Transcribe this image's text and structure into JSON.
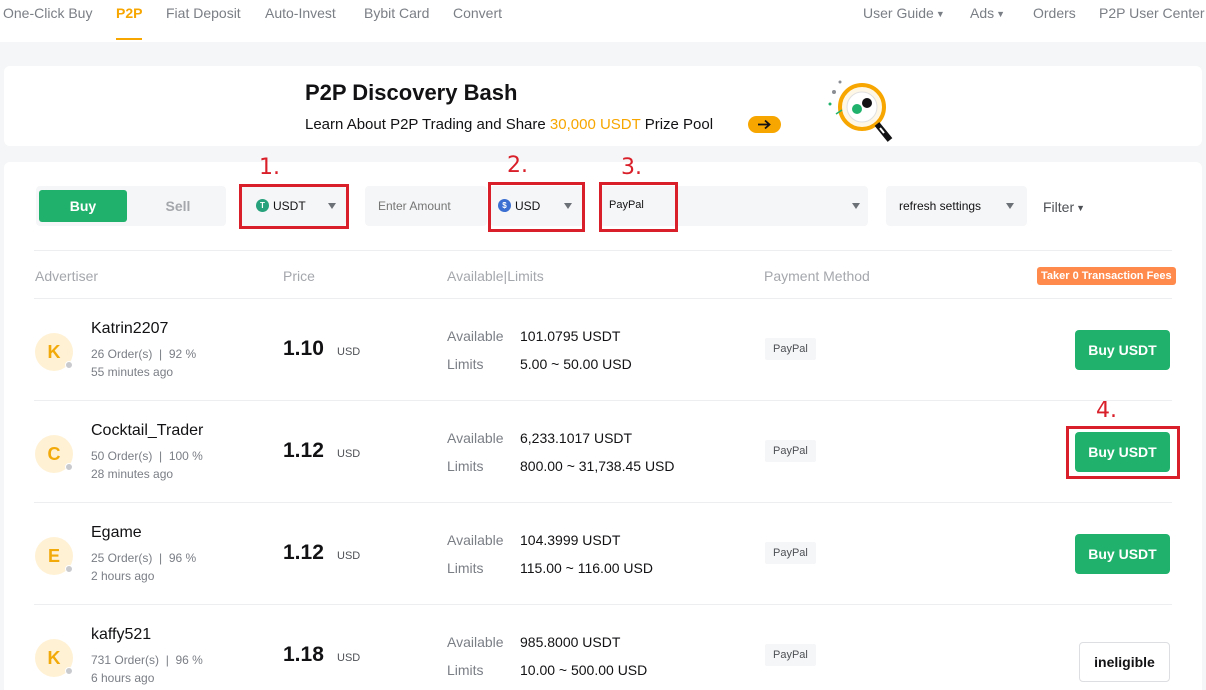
{
  "nav": {
    "left_items": [
      {
        "label": "One-Click Buy"
      },
      {
        "label": "P2P"
      },
      {
        "label": "Fiat Deposit"
      },
      {
        "label": "Auto-Invest"
      },
      {
        "label": "Bybit Card"
      },
      {
        "label": "Convert"
      }
    ],
    "active_item": "P2P",
    "right_items": [
      {
        "label": "User Guide"
      },
      {
        "label": "Ads"
      },
      {
        "label": "Orders"
      },
      {
        "label": "P2P User Center"
      }
    ]
  },
  "banner": {
    "title": "P2P Discovery Bash",
    "subtitle_before": "Learn About P2P Trading and Share ",
    "subtitle_highlight": "30,000 USDT",
    "subtitle_after": " Prize Pool",
    "accent_color": "#f7a600"
  },
  "filters": {
    "buy_label": "Buy",
    "sell_label": "Sell",
    "crypto": {
      "value": "USDT",
      "icon": "tether-coin-icon"
    },
    "amount_placeholder": "Enter Amount",
    "fiat": {
      "value": "USD",
      "icon": "dollar-coin-icon"
    },
    "payment": {
      "value": "PayPal"
    },
    "refresh": {
      "value": "refresh settings"
    },
    "filter_label": "Filter"
  },
  "annotations": {
    "step1": "1.",
    "step2": "2.",
    "step3": "3.",
    "step4": "4.",
    "color": "#d9202a"
  },
  "table": {
    "headers": {
      "advertiser": "Advertiser",
      "price": "Price",
      "available_limits": "Available|Limits",
      "payment_method": "Payment Method"
    },
    "fee_badge": "Taker 0 Transaction Fees",
    "available_label": "Available",
    "limits_label": "Limits",
    "rows": [
      {
        "initial": "K",
        "name": "Katrin2207",
        "orders": "26 Order(s)",
        "completion": "92 %",
        "last_seen": "55 minutes ago",
        "price": "1.10",
        "price_currency": "USD",
        "available": "101.0795 USDT",
        "limits": "5.00 ~ 50.00 USD",
        "payment": "PayPal",
        "action": "Buy USDT"
      },
      {
        "initial": "C",
        "name": "Cocktail_Trader",
        "orders": "50 Order(s)",
        "completion": "100 %",
        "last_seen": "28 minutes ago",
        "price": "1.12",
        "price_currency": "USD",
        "available": "6,233.1017 USDT",
        "limits": "800.00 ~ 31,738.45 USD",
        "payment": "PayPal",
        "action": "Buy USDT"
      },
      {
        "initial": "E",
        "name": "Egame",
        "orders": "25 Order(s)",
        "completion": "96 %",
        "last_seen": "2 hours ago",
        "price": "1.12",
        "price_currency": "USD",
        "available": "104.3999 USDT",
        "limits": "115.00 ~ 116.00 USD",
        "payment": "PayPal",
        "action": "Buy USDT"
      },
      {
        "initial": "K",
        "name": "kaffy521",
        "orders": "731 Order(s)",
        "completion": "96 %",
        "last_seen": "6 hours ago",
        "price": "1.18",
        "price_currency": "USD",
        "available": "985.8000 USDT",
        "limits": "10.00 ~ 500.00 USD",
        "payment": "PayPal",
        "action": "ineligible"
      }
    ]
  },
  "colors": {
    "primary_green": "#20b26c",
    "brand_orange": "#f7a600",
    "fee_badge": "#ff8a4c"
  }
}
